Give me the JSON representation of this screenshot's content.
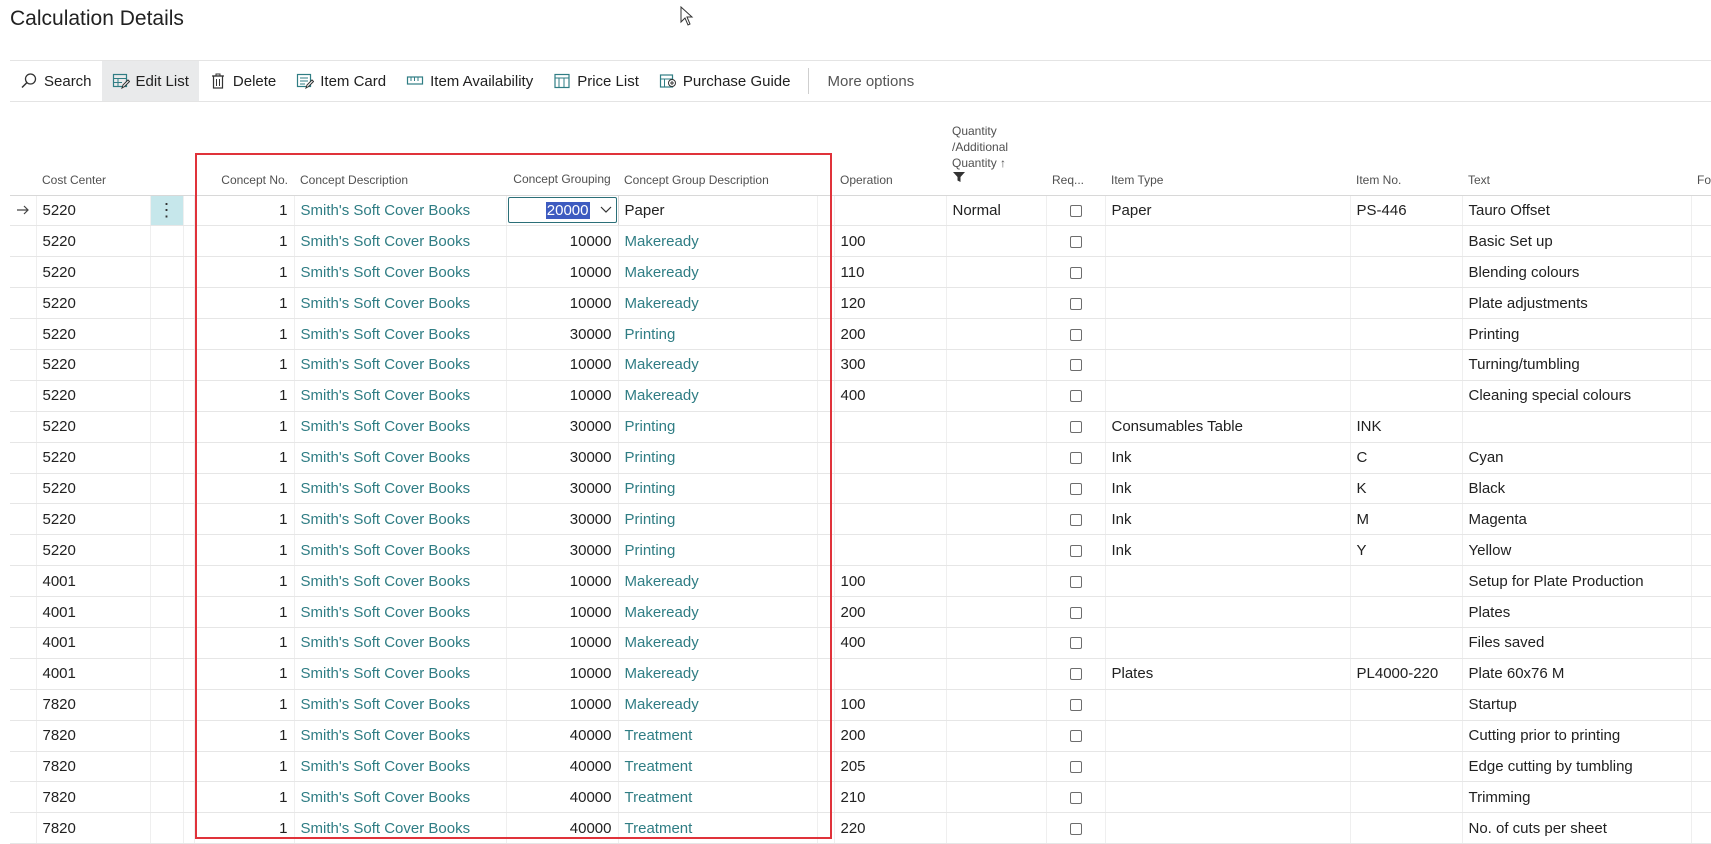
{
  "page": {
    "title": "Calculation Details"
  },
  "toolbar": {
    "search": "Search",
    "edit_list": "Edit List",
    "delete": "Delete",
    "item_card": "Item Card",
    "item_availability": "Item Availability",
    "price_list": "Price List",
    "purchase_guide": "Purchase Guide",
    "more_options": "More options"
  },
  "columns": {
    "cost_center": "Cost Center",
    "concept_no": "Concept No.",
    "concept_description": "Concept Description",
    "concept_grouping": "Concept Grouping",
    "concept_group_description": "Concept Group Description",
    "operation": "Operation",
    "quantity": "Quantity /Additional Quantity ↑",
    "req": "Req...",
    "item_type": "Item Type",
    "item_no": "Item No.",
    "text": "Text",
    "next": "Fo"
  },
  "rows": [
    {
      "cost_center": "5220",
      "concept_no": "1",
      "concept_description": "Smith's Soft Cover Books",
      "concept_grouping": "20000",
      "concept_group_description": "Paper",
      "operation": "",
      "quantity": "Normal",
      "item_type": "Paper",
      "item_no": "PS-446",
      "text": "Tauro Offset"
    },
    {
      "cost_center": "5220",
      "concept_no": "1",
      "concept_description": "Smith's Soft Cover Books",
      "concept_grouping": "10000",
      "concept_group_description": "Makeready",
      "operation": "100",
      "quantity": "",
      "item_type": "",
      "item_no": "",
      "text": "Basic Set up"
    },
    {
      "cost_center": "5220",
      "concept_no": "1",
      "concept_description": "Smith's Soft Cover Books",
      "concept_grouping": "10000",
      "concept_group_description": "Makeready",
      "operation": "110",
      "quantity": "",
      "item_type": "",
      "item_no": "",
      "text": "Blending colours"
    },
    {
      "cost_center": "5220",
      "concept_no": "1",
      "concept_description": "Smith's Soft Cover Books",
      "concept_grouping": "10000",
      "concept_group_description": "Makeready",
      "operation": "120",
      "quantity": "",
      "item_type": "",
      "item_no": "",
      "text": "Plate adjustments"
    },
    {
      "cost_center": "5220",
      "concept_no": "1",
      "concept_description": "Smith's Soft Cover Books",
      "concept_grouping": "30000",
      "concept_group_description": "Printing",
      "operation": "200",
      "quantity": "",
      "item_type": "",
      "item_no": "",
      "text": "Printing"
    },
    {
      "cost_center": "5220",
      "concept_no": "1",
      "concept_description": "Smith's Soft Cover Books",
      "concept_grouping": "10000",
      "concept_group_description": "Makeready",
      "operation": "300",
      "quantity": "",
      "item_type": "",
      "item_no": "",
      "text": "Turning/tumbling"
    },
    {
      "cost_center": "5220",
      "concept_no": "1",
      "concept_description": "Smith's Soft Cover Books",
      "concept_grouping": "10000",
      "concept_group_description": "Makeready",
      "operation": "400",
      "quantity": "",
      "item_type": "",
      "item_no": "",
      "text": "Cleaning special colours"
    },
    {
      "cost_center": "5220",
      "concept_no": "1",
      "concept_description": "Smith's Soft Cover Books",
      "concept_grouping": "30000",
      "concept_group_description": "Printing",
      "operation": "",
      "quantity": "",
      "item_type": "Consumables Table",
      "item_no": "INK",
      "text": ""
    },
    {
      "cost_center": "5220",
      "concept_no": "1",
      "concept_description": "Smith's Soft Cover Books",
      "concept_grouping": "30000",
      "concept_group_description": "Printing",
      "operation": "",
      "quantity": "",
      "item_type": "Ink",
      "item_no": "C",
      "text": "Cyan"
    },
    {
      "cost_center": "5220",
      "concept_no": "1",
      "concept_description": "Smith's Soft Cover Books",
      "concept_grouping": "30000",
      "concept_group_description": "Printing",
      "operation": "",
      "quantity": "",
      "item_type": "Ink",
      "item_no": "K",
      "text": "Black"
    },
    {
      "cost_center": "5220",
      "concept_no": "1",
      "concept_description": "Smith's Soft Cover Books",
      "concept_grouping": "30000",
      "concept_group_description": "Printing",
      "operation": "",
      "quantity": "",
      "item_type": "Ink",
      "item_no": "M",
      "text": "Magenta"
    },
    {
      "cost_center": "5220",
      "concept_no": "1",
      "concept_description": "Smith's Soft Cover Books",
      "concept_grouping": "30000",
      "concept_group_description": "Printing",
      "operation": "",
      "quantity": "",
      "item_type": "Ink",
      "item_no": "Y",
      "text": "Yellow"
    },
    {
      "cost_center": "4001",
      "concept_no": "1",
      "concept_description": "Smith's Soft Cover Books",
      "concept_grouping": "10000",
      "concept_group_description": "Makeready",
      "operation": "100",
      "quantity": "",
      "item_type": "",
      "item_no": "",
      "text": "Setup for Plate Production"
    },
    {
      "cost_center": "4001",
      "concept_no": "1",
      "concept_description": "Smith's Soft Cover Books",
      "concept_grouping": "10000",
      "concept_group_description": "Makeready",
      "operation": "200",
      "quantity": "",
      "item_type": "",
      "item_no": "",
      "text": "Plates"
    },
    {
      "cost_center": "4001",
      "concept_no": "1",
      "concept_description": "Smith's Soft Cover Books",
      "concept_grouping": "10000",
      "concept_group_description": "Makeready",
      "operation": "400",
      "quantity": "",
      "item_type": "",
      "item_no": "",
      "text": "Files saved"
    },
    {
      "cost_center": "4001",
      "concept_no": "1",
      "concept_description": "Smith's Soft Cover Books",
      "concept_grouping": "10000",
      "concept_group_description": "Makeready",
      "operation": "",
      "quantity": "",
      "item_type": "Plates",
      "item_no": "PL4000-220",
      "text": "Plate 60x76 M"
    },
    {
      "cost_center": "7820",
      "concept_no": "1",
      "concept_description": "Smith's Soft Cover Books",
      "concept_grouping": "10000",
      "concept_group_description": "Makeready",
      "operation": "100",
      "quantity": "",
      "item_type": "",
      "item_no": "",
      "text": "Startup"
    },
    {
      "cost_center": "7820",
      "concept_no": "1",
      "concept_description": "Smith's Soft Cover Books",
      "concept_grouping": "40000",
      "concept_group_description": "Treatment",
      "operation": "200",
      "quantity": "",
      "item_type": "",
      "item_no": "",
      "text": "Cutting prior to printing"
    },
    {
      "cost_center": "7820",
      "concept_no": "1",
      "concept_description": "Smith's Soft Cover Books",
      "concept_grouping": "40000",
      "concept_group_description": "Treatment",
      "operation": "205",
      "quantity": "",
      "item_type": "",
      "item_no": "",
      "text": "Edge cutting by tumbling"
    },
    {
      "cost_center": "7820",
      "concept_no": "1",
      "concept_description": "Smith's Soft Cover Books",
      "concept_grouping": "40000",
      "concept_group_description": "Treatment",
      "operation": "210",
      "quantity": "",
      "item_type": "",
      "item_no": "",
      "text": "Trimming"
    },
    {
      "cost_center": "7820",
      "concept_no": "1",
      "concept_description": "Smith's Soft Cover Books",
      "concept_grouping": "40000",
      "concept_group_description": "Treatment",
      "operation": "220",
      "quantity": "",
      "item_type": "",
      "item_no": "",
      "text": "No. of cuts per sheet"
    }
  ],
  "colors": {
    "accent": "#2f7d84",
    "highlight_box": "#e0323a",
    "selection": "#3d5bc0",
    "row_menu": "#c6e7eb"
  },
  "icons": {
    "search": "search-icon",
    "edit_list": "edit-list-icon",
    "delete": "delete-icon",
    "item_card": "item-card-icon",
    "item_availability": "item-availability-icon",
    "price_list": "price-list-icon",
    "purchase_guide": "purchase-guide-icon",
    "row_arrow": "row-arrow-icon",
    "row_menu": "more-vertical-icon",
    "filter": "filter-icon",
    "dropdown": "chevron-down-icon"
  }
}
